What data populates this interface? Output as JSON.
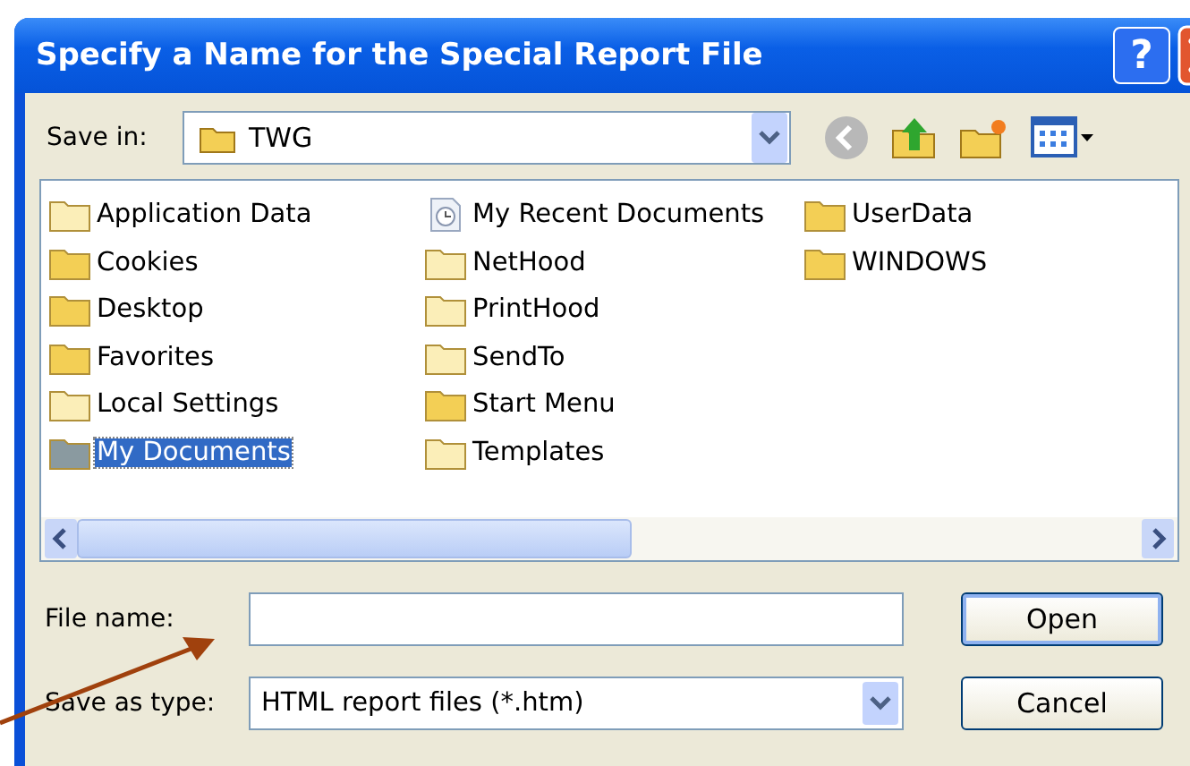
{
  "window": {
    "title": "Specify a Name for the Special Report File",
    "help_label": "?"
  },
  "save_in": {
    "label": "Save in:",
    "value": "TWG"
  },
  "files": [
    {
      "name": "Application Data",
      "kind": "plain",
      "selected": false
    },
    {
      "name": "Cookies",
      "kind": "folder",
      "selected": false
    },
    {
      "name": "Desktop",
      "kind": "folder",
      "selected": false
    },
    {
      "name": "Favorites",
      "kind": "folder",
      "selected": false
    },
    {
      "name": "Local Settings",
      "kind": "plain",
      "selected": false
    },
    {
      "name": "My Documents",
      "kind": "folder",
      "selected": true
    },
    {
      "name": "My Recent Documents",
      "kind": "recent",
      "selected": false
    },
    {
      "name": "NetHood",
      "kind": "plain",
      "selected": false
    },
    {
      "name": "PrintHood",
      "kind": "plain",
      "selected": false
    },
    {
      "name": "SendTo",
      "kind": "plain",
      "selected": false
    },
    {
      "name": "Start Menu",
      "kind": "folder",
      "selected": false
    },
    {
      "name": "Templates",
      "kind": "plain",
      "selected": false
    },
    {
      "name": "UserData",
      "kind": "folder",
      "selected": false
    },
    {
      "name": "WINDOWS",
      "kind": "folder",
      "selected": false
    }
  ],
  "file_name": {
    "label": "File name:"
  },
  "save_as_type": {
    "label": "Save as type:",
    "value": "HTML report files (*.htm)"
  },
  "buttons": [
    {
      "label": "Open",
      "default": true
    },
    {
      "label": "Cancel",
      "default": false
    }
  ]
}
